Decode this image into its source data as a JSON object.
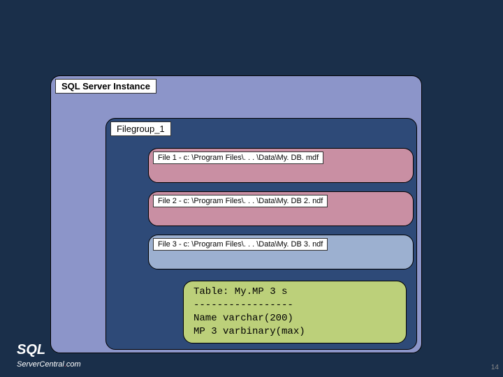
{
  "instance": {
    "label": "SQL Server Instance"
  },
  "filegroup": {
    "label": "Filegroup_1",
    "files": [
      {
        "label": "File 1 - c: \\Program Files\\. . . \\Data\\My. DB. mdf"
      },
      {
        "label": "File 2 - c: \\Program Files\\. . . \\Data\\My. DB 2. ndf"
      },
      {
        "label": "File 3 - c: \\Program Files\\. . . \\Data\\My. DB 3. ndf"
      }
    ],
    "table": {
      "line1": "Table: My.MP 3 s",
      "line2": "-----------------",
      "line3": "Name varchar(200)",
      "line4": "MP 3 varbinary(max)"
    }
  },
  "footer": {
    "logo_main": "SQL",
    "logo_sub_prefix": "ServerCentral",
    "logo_sub_dot": ".",
    "logo_sub_suffix": "com",
    "page_number": "14"
  }
}
